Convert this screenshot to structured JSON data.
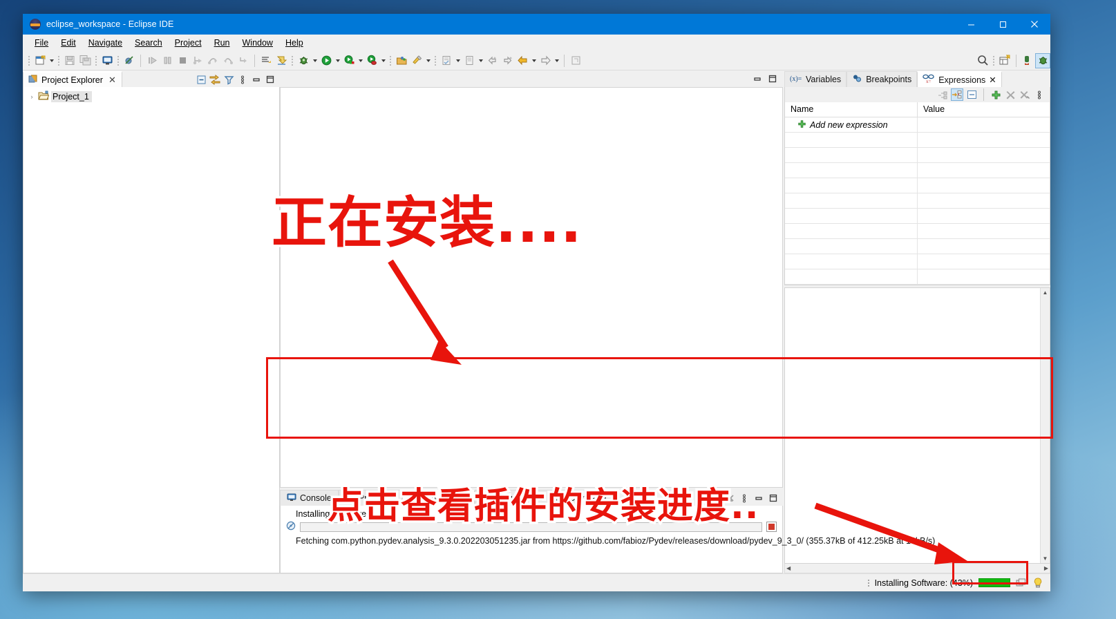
{
  "window": {
    "title": "eclipse_workspace - Eclipse IDE",
    "app_icon": "eclipse-icon",
    "minimize": "minimize-button",
    "maximize": "maximize-button",
    "close": "close-button"
  },
  "menubar": {
    "items": [
      {
        "label": "File",
        "mnemonic": "F"
      },
      {
        "label": "Edit",
        "mnemonic": "E"
      },
      {
        "label": "Navigate",
        "mnemonic": "N"
      },
      {
        "label": "Search",
        "mnemonic": "e"
      },
      {
        "label": "Project",
        "mnemonic": "P"
      },
      {
        "label": "Run",
        "mnemonic": "R"
      },
      {
        "label": "Window",
        "mnemonic": "W"
      },
      {
        "label": "Help",
        "mnemonic": "H"
      }
    ]
  },
  "toolbar": {
    "icons": [
      "new-wizard-icon",
      "save-icon",
      "save-all-icon",
      "new-java-console-icon",
      "toggle-breakpoint-icon",
      "resume-icon",
      "suspend-icon",
      "terminate-icon",
      "step-into-icon",
      "step-over-icon",
      "step-return-icon",
      "drop-to-frame-icon",
      "use-step-filters-icon",
      "skip-all-breakpoints-icon",
      "debug-icon",
      "run-icon",
      "coverage-icon",
      "external-tools-icon",
      "new-java-project-icon",
      "new-class-icon",
      "previous-annotation-icon",
      "next-annotation-icon",
      "back-icon",
      "forward-icon",
      "pin-editor-icon",
      "search-icon",
      "open-perspective-icon",
      "java-perspective-icon",
      "debug-perspective-icon"
    ]
  },
  "project_explorer": {
    "tab_label": "Project Explorer",
    "tab_icon": "project-explorer-icon",
    "close_glyph": "✕",
    "tools": [
      "collapse-all-icon",
      "link-with-editor-icon",
      "view-filter-icon",
      "view-menu-icon",
      "minimize-icon",
      "maximize-icon"
    ],
    "tree": [
      {
        "label": "Project_1",
        "expand_glyph": "›",
        "icon": "project-folder-icon",
        "selected": true
      }
    ]
  },
  "editor_area": {
    "tools": [
      "minimize-icon",
      "maximize-icon"
    ]
  },
  "bottom_panel": {
    "tabs": [
      {
        "label": "Console",
        "icon": "console-icon",
        "active": false,
        "closable": false
      },
      {
        "label": "Problems",
        "icon": "problems-icon",
        "active": false,
        "closable": false
      },
      {
        "label": "Progress",
        "icon": "progress-icon",
        "active": true,
        "closable": true
      },
      {
        "label": "Debug Shell",
        "icon": "debug-shell-icon",
        "active": false,
        "closable": false
      },
      {
        "label": "Coverage",
        "icon": "coverage-icon",
        "active": false,
        "closable": false
      }
    ],
    "close_glyph": "✕",
    "tools": [
      "clear-icon",
      "view-menu-icon",
      "minimize-icon",
      "maximize-icon"
    ],
    "progress": {
      "job_title": "Installing Software",
      "percent": 43,
      "job_icon": "progress-job-icon",
      "stop_button": "stop-job-button",
      "detail": "Fetching com.python.pydev.analysis_9.3.0.202203051235.jar from https://github.com/fabioz/Pydev/releases/download/pydev_9_3_0/ (355.37kB of 412.25kB at 16kB/s)"
    }
  },
  "right_panel": {
    "tabs": [
      {
        "label": "Variables",
        "icon": "variables-icon",
        "active": false,
        "closable": false
      },
      {
        "label": "Breakpoints",
        "icon": "breakpoints-icon",
        "active": false,
        "closable": false
      },
      {
        "label": "Expressions",
        "icon": "expressions-icon",
        "active": true,
        "closable": true
      }
    ],
    "close_glyph": "✕",
    "tools": [
      "show-logical-structure-icon",
      "collapse-all-icon",
      "show-details-pane-icon",
      "add-expression-icon",
      "remove-selected-icon",
      "remove-all-icon",
      "view-menu-icon"
    ],
    "columns": [
      "Name",
      "Value"
    ],
    "rows": [
      {
        "name": "Add new expression",
        "value": "",
        "icon": "add-icon",
        "italic": true
      },
      {
        "name": "",
        "value": ""
      },
      {
        "name": "",
        "value": ""
      },
      {
        "name": "",
        "value": ""
      },
      {
        "name": "",
        "value": ""
      },
      {
        "name": "",
        "value": ""
      },
      {
        "name": "",
        "value": ""
      },
      {
        "name": "",
        "value": ""
      },
      {
        "name": "",
        "value": ""
      },
      {
        "name": "",
        "value": ""
      }
    ]
  },
  "statusbar": {
    "job_status": "Installing Software: (43%)",
    "progress_percent": 43,
    "progress_color": "#11bb11",
    "jobs_icon": "background-jobs-icon",
    "tip_icon": "tip-of-the-day-icon"
  },
  "annotations": [
    {
      "id": "anno-installing",
      "text": "正在安装....",
      "color": "#e8140c",
      "outline": "#ffffff"
    },
    {
      "id": "anno-click-progress",
      "text": "点击查看插件的安装进度..",
      "color": "#e8140c",
      "outline": "#ffffff"
    }
  ],
  "highlight_boxes": [
    {
      "id": "progress-view-box",
      "color": "#e8140c"
    },
    {
      "id": "status-progress-box",
      "color": "#e8140c"
    }
  ]
}
